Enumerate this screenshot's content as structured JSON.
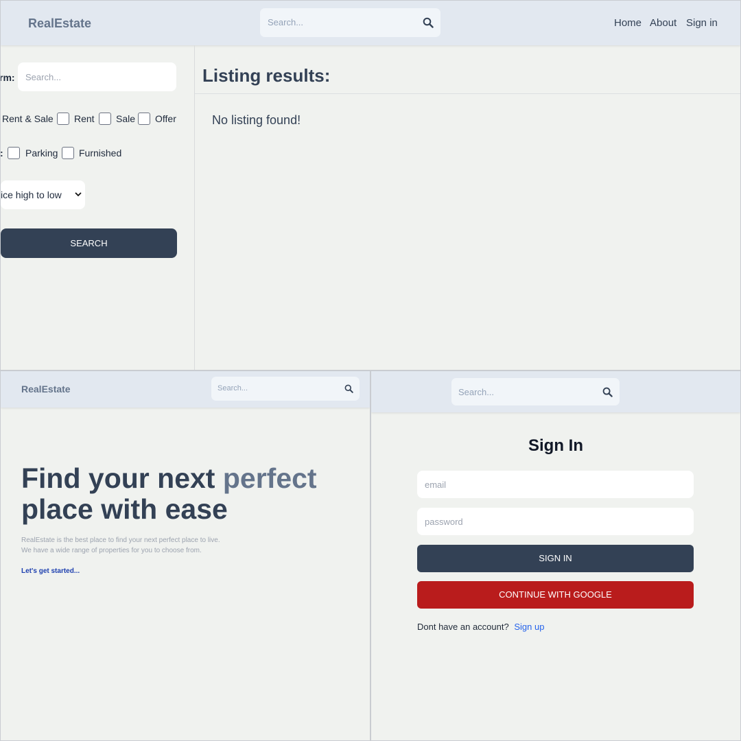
{
  "search_page": {
    "brand": "RealEstate",
    "search_placeholder": "Search...",
    "nav": {
      "home": "Home",
      "about": "About",
      "sign_in": "Sign in"
    },
    "sidebar": {
      "term_label": "rm:",
      "term_placeholder": "Search...",
      "type_options": [
        "Rent & Sale",
        "Rent",
        "Sale",
        "Offer"
      ],
      "amenities_label": ":",
      "amenities_options": [
        "Parking",
        "Furnished"
      ],
      "sort_value": "ice high to low",
      "search_button": "SEARCH"
    },
    "results_title": "Listing results:",
    "empty_message": "No listing found!"
  },
  "home_page": {
    "brand": "RealEstate",
    "search_placeholder": "Search...",
    "hero_line1_a": "Find your next ",
    "hero_line1_b": "perfect",
    "hero_line2": "place with ease",
    "description_line1": "RealEstate is the best place to find your next perfect place to live.",
    "description_line2": "We have a wide range of properties for you to choose from.",
    "cta_link": "Let's get started..."
  },
  "signin_page": {
    "search_placeholder": "Search...",
    "title": "Sign In",
    "email_placeholder": "email",
    "password_placeholder": "password",
    "signin_button": "SIGN IN",
    "google_button": "CONTINUE WITH GOOGLE",
    "no_account_text": "Dont have an account?",
    "signup_link": "Sign up"
  },
  "icons": {
    "search": "search-icon",
    "select_arrow": "chevron-down-icon"
  },
  "colors": {
    "header_bg": "#e2e8f0",
    "page_bg": "#f0f2ef",
    "dark_button": "#334155",
    "google_button": "#b91c1c",
    "accent_text": "#64748b",
    "link": "#1d4ed8"
  }
}
